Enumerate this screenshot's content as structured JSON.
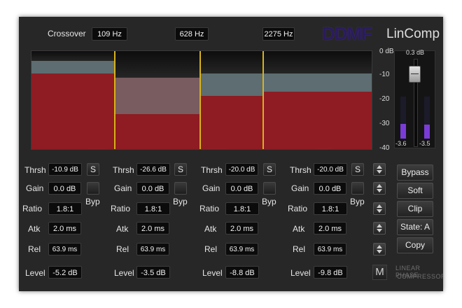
{
  "header": {
    "crossover_label": "Crossover",
    "frequencies": [
      "109 Hz",
      "628 Hz",
      "2275 Hz"
    ],
    "brand_logo": "DDMF",
    "product_name": "LinComp"
  },
  "meter_scale": {
    "ticks": [
      "0 dB",
      "-10",
      "-20",
      "-30",
      "-40"
    ],
    "top_readout": "0.3 dB",
    "left_readout": "-3.6",
    "right_readout": "-3.5",
    "left_level": 0.35,
    "right_level": 0.33,
    "fader_level": 0.9
  },
  "spectrum": {
    "colors": {
      "gain_fill": "#8e1c22",
      "reduction_fill": "#5d6d71",
      "divider": "#d7b21c"
    }
  },
  "bands": [
    {
      "thrsh_label": "Thrsh",
      "thrsh": "-10.9 dB",
      "solo_label": "S",
      "gain_label": "Gain",
      "gain": "0.0 dB",
      "byp_label": "Byp",
      "ratio_label": "Ratio",
      "ratio": "1.8:1",
      "atk_label": "Atk",
      "atk": "2.0 ms",
      "rel_label": "Rel",
      "rel": "63.9 ms",
      "level_label": "Level",
      "level": "-5.2 dB"
    },
    {
      "thrsh_label": "Thrsh",
      "thrsh": "-26.6 dB",
      "solo_label": "S",
      "gain_label": "Gain",
      "gain": "0.0 dB",
      "byp_label": "Byp",
      "ratio_label": "Ratio",
      "ratio": "1.8:1",
      "atk_label": "Atk",
      "atk": "2.0 ms",
      "rel_label": "Rel",
      "rel": "63.9 ms",
      "level_label": "Level",
      "level": "-3.5 dB"
    },
    {
      "thrsh_label": "Thrsh",
      "thrsh": "-20.0 dB",
      "solo_label": "S",
      "gain_label": "Gain",
      "gain": "0.0 dB",
      "byp_label": "Byp",
      "ratio_label": "Ratio",
      "ratio": "1.8:1",
      "atk_label": "Atk",
      "atk": "2.0 ms",
      "rel_label": "Rel",
      "rel": "63.9 ms",
      "level_label": "Level",
      "level": "-8.8 dB"
    },
    {
      "thrsh_label": "Thrsh",
      "thrsh": "-20.0 dB",
      "solo_label": "S",
      "gain_label": "Gain",
      "gain": "0.0 dB",
      "byp_label": "Byp",
      "ratio_label": "Ratio",
      "ratio": "1.8:1",
      "atk_label": "Atk",
      "atk": "2.0 ms",
      "rel_label": "Rel",
      "rel": "63.9 ms",
      "level_label": "Level",
      "level": "-9.8 dB"
    }
  ],
  "side_buttons": {
    "bypass": "Bypass",
    "soft": "Soft",
    "clip": "Clip",
    "state": "State: A",
    "copy": "Copy"
  },
  "mono_label": "M",
  "tagline": {
    "line1": "LINEAR PHASE",
    "line2": "COMPRESSOR"
  }
}
